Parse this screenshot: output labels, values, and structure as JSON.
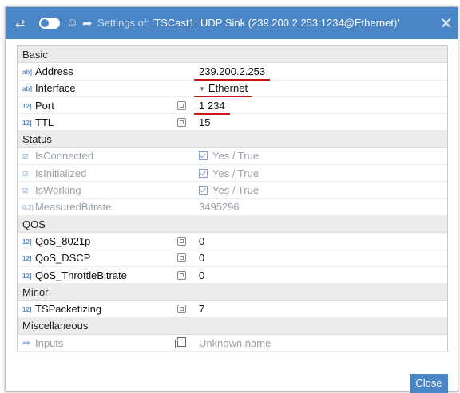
{
  "dialog": {
    "title_prefix": "Settings of:",
    "title": "'TSCast1: UDP Sink (239.200.2.253:1234@Ethernet)'",
    "close_label": "Close"
  },
  "sections": {
    "basic": "Basic",
    "status": "Status",
    "qos": "QOS",
    "minor": "Minor",
    "misc": "Miscellaneous"
  },
  "type_labels": {
    "string": "ab]",
    "integer": "12]",
    "float": "0.3]"
  },
  "basic": {
    "address": {
      "name": "Address",
      "value": "239.200.2.253"
    },
    "interface": {
      "name": "Interface",
      "value": "Ethernet"
    },
    "port": {
      "name": "Port",
      "value": "1 234"
    },
    "ttl": {
      "name": "TTL",
      "value": "15"
    }
  },
  "status": {
    "is_connected": {
      "name": "IsConnected",
      "value": "Yes / True"
    },
    "is_initialized": {
      "name": "IsInitialized",
      "value": "Yes / True"
    },
    "is_working": {
      "name": "IsWorking",
      "value": "Yes / True"
    },
    "measured_bitrate": {
      "name": "MeasuredBitrate",
      "value": "3495296"
    }
  },
  "qos": {
    "qos_8021p": {
      "name": "QoS_8021p",
      "value": "0"
    },
    "qos_dscp": {
      "name": "QoS_DSCP",
      "value": "0"
    },
    "qos_throttle": {
      "name": "QoS_ThrottleBitrate",
      "value": "0"
    }
  },
  "minor": {
    "ts_packetizing": {
      "name": "TSPacketizing",
      "value": "7"
    }
  },
  "misc": {
    "inputs": {
      "name": "Inputs",
      "value": "Unknown name"
    }
  },
  "colors": {
    "titlebar": "#4a86c5",
    "highlight": "#d01818",
    "section_bg": "#ececec"
  }
}
